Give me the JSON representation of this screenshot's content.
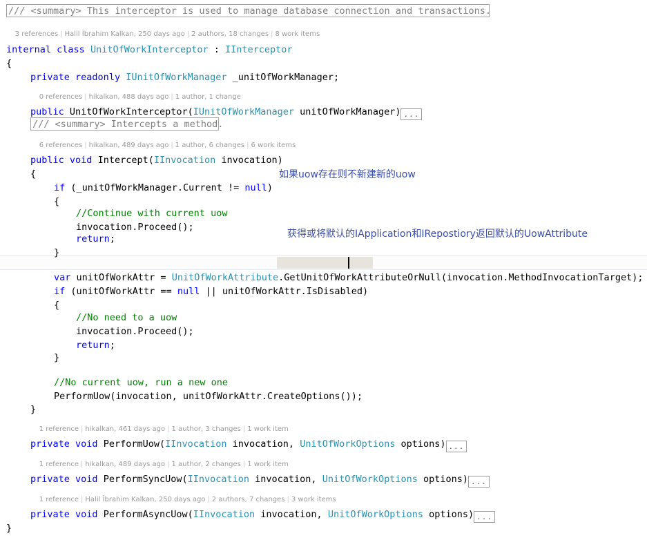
{
  "document": {
    "language": "csharp",
    "background": "#ffffff",
    "colors": {
      "keyword": "#0000ff",
      "type": "#2b91af",
      "comment": "#008000",
      "doc_comment": "#808080",
      "plain_text": "#000000",
      "codelens": "#9a9a9a",
      "annotation": "#3b4ea8",
      "word_highlight": "#e6e4dd",
      "current_line_border": "#e6eaf0"
    }
  },
  "summaries": [
    {
      "text": "/// <summary> This interceptor is used to manage database connection and transactions."
    },
    {
      "text": "/// <summary> Intercepts a method."
    }
  ],
  "codelens": [
    {
      "references": "3 references",
      "author": "Halil İbrahim Kalkan, 250 days ago",
      "changes": "2 authors, 18 changes",
      "work_items": "8 work items"
    },
    {
      "references": "0 references",
      "author": "hikalkan, 488 days ago",
      "changes": "1 author, 1 change",
      "work_items": ""
    },
    {
      "references": "6 references",
      "author": "hikalkan, 489 days ago",
      "changes": "1 author, 6 changes",
      "work_items": "6 work items"
    },
    {
      "references": "1 reference",
      "author": "hikalkan, 461 days ago",
      "changes": "1 author, 3 changes",
      "work_items": "1 work item"
    },
    {
      "references": "1 reference",
      "author": "hikalkan, 489 days ago",
      "changes": "1 author, 2 changes",
      "work_items": "1 work item"
    },
    {
      "references": "1 reference",
      "author": "Halil İbrahim Kalkan, 250 days ago",
      "changes": "2 authors, 7 changes",
      "work_items": "3 work items"
    }
  ],
  "code": {
    "class_decl": {
      "kw_internal": "internal",
      "kw_class": "class",
      "name": "UnitOfWorkInterceptor",
      "colon": " : ",
      "interface": "IInterceptor"
    },
    "open_brace": "{",
    "field": {
      "kw_private": "private",
      "kw_readonly": "readonly",
      "type": "IUnitOfWorkManager",
      "name": " _unitOfWorkManager;"
    },
    "ctor": {
      "kw_public": "public",
      "name": "UnitOfWorkInterceptor(",
      "param_type": "IUnitOfWorkManager",
      "param_name": " unitOfWorkManager)",
      "ellipsis": "..."
    },
    "intercept": {
      "kw_public": "public",
      "kw_void": "void",
      "name": "Intercept(",
      "param_type": "IInvocation",
      "param_name": " invocation)"
    },
    "intercept_open": "{",
    "if_current": {
      "kw_if": "if",
      "expr": " (_unitOfWorkManager.Current != ",
      "kw_null": "null",
      "close": ")"
    },
    "if_current_open": "{",
    "comment_continue": "//Continue with current uow",
    "proceed_1": "invocation.Proceed();",
    "return_1": "return",
    "return_1_semi": ";",
    "if_current_close": "}",
    "var_line": {
      "kw_var": "var",
      "assign": " unitOfWorkAttr = ",
      "type": "UnitOfWorkAttribute",
      "member_pre": ".GetUnitOfWork",
      "member_post": "AttributeOrNull",
      "args": "(invocation.MethodInvocationTarget);"
    },
    "if_attr": {
      "kw_if": "if",
      "expr_pre": " (unitOfWorkAttr == ",
      "kw_null": "null",
      "expr_post": " || unitOfWorkAttr.IsDisabled)"
    },
    "if_attr_open": "{",
    "comment_noneed": "//No need to a uow",
    "proceed_2": "invocation.Proceed();",
    "return_2": "return",
    "return_2_semi": ";",
    "if_attr_close": "}",
    "comment_nocurrent": "//No current uow, run a new one",
    "perform_uow_call": "PerformUow(invocation, unitOfWorkAttr.CreateOptions());",
    "intercept_close": "}",
    "perform_uow": {
      "kw_private": "private",
      "kw_void": "void",
      "name": "PerformUow(",
      "param_type1": "IInvocation",
      "param_mid": " invocation, ",
      "param_type2": "UnitOfWorkOptions",
      "param_end": " options)",
      "ellipsis": "..."
    },
    "perform_sync_uow": {
      "kw_private": "private",
      "kw_void": "void",
      "name": "PerformSyncUow(",
      "param_type1": "IInvocation",
      "param_mid": " invocation, ",
      "param_type2": "UnitOfWorkOptions",
      "param_end": " options)",
      "ellipsis": "..."
    },
    "perform_async_uow": {
      "kw_private": "private",
      "kw_void": "void",
      "name": "PerformAsyncUow(",
      "param_type1": "IInvocation",
      "param_mid": " invocation, ",
      "param_type2": "UnitOfWorkOptions",
      "param_end": " options)",
      "ellipsis": "..."
    },
    "class_close": "}"
  },
  "annotations": [
    {
      "text": "如果uow存在则不新建新的uow"
    },
    {
      "text": "获得或将默认的IApplication和IRepostiory返回默认的UowAttribute"
    }
  ]
}
